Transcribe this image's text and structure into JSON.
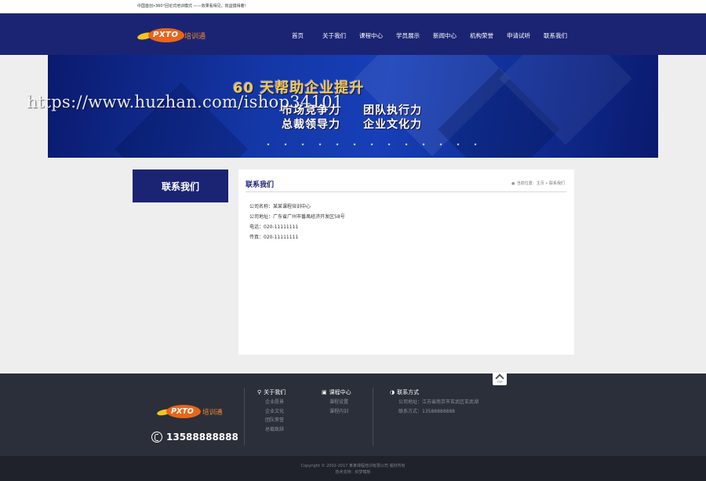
{
  "topbar": {
    "slogan": "中国首创•360°回论式培训模式 ——效果看得见，效益摸得着！"
  },
  "brand": {
    "logo_mark": "PXTO",
    "logo_cn": "培训通"
  },
  "nav": {
    "items": [
      {
        "label": "首页"
      },
      {
        "label": "关于我们"
      },
      {
        "label": "课程中心"
      },
      {
        "label": "学员展示"
      },
      {
        "label": "新闻中心"
      },
      {
        "label": "机构荣誉"
      },
      {
        "label": "申请试听"
      },
      {
        "label": "联系我们"
      }
    ]
  },
  "banner": {
    "headline": "60 天帮助企业提升",
    "line2_left": "市场竞争力",
    "line2_right": "团队执行力",
    "line3_left": "总裁领导力",
    "line3_right": "企业文化力",
    "watermark": "https://www.huzhan.com/ishop34101"
  },
  "sidebar": {
    "title": "联系我们"
  },
  "content": {
    "title": "联系我们",
    "breadcrumb": {
      "prefix": "当前位置：",
      "home": "主页",
      "sep": "»",
      "current": "联系我们"
    },
    "info": [
      "公司名称：某某课程培训中心",
      "公司地址：广东省广州市番禺经济开发区58号",
      "电话：020-11111111",
      "传真：020-11111111"
    ]
  },
  "totop": {
    "label": "TOP"
  },
  "footer": {
    "phone": "13588888888",
    "col_about": {
      "title": "关于我们",
      "icon": "location-pin-icon",
      "links": [
        "企业愿景",
        "企业文化",
        "团队荣誉",
        "总裁致辞"
      ]
    },
    "col_course": {
      "title": "课程中心",
      "icon": "lock-icon",
      "links": [
        "课程设置",
        "课程内训"
      ]
    },
    "col_contact": {
      "title": "联系方式",
      "icon": "compass-icon",
      "lines": [
        "公司地址：江苏省南京市玄武区玄武湖",
        "联系方式：13588888888"
      ]
    },
    "copyright": "Copyright © 2002-2017 某某课程培训有限公司 版权所有",
    "support": "技术支持：织梦模板"
  },
  "colors": {
    "navy": "#1b2473",
    "footer_bg": "#2b2f3a",
    "copy_bg": "#1f222b",
    "accent_orange": "#e8661b",
    "accent_yellow": "#f6c948"
  }
}
